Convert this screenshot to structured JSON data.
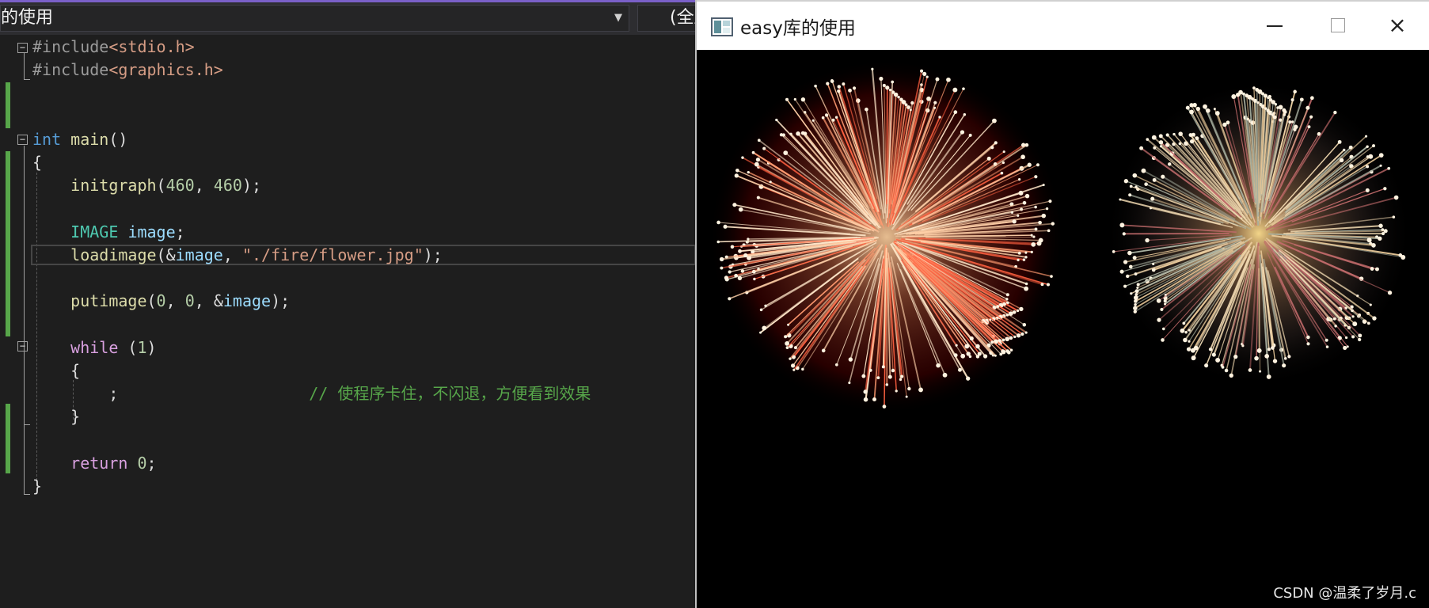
{
  "editor": {
    "scope_dropdown": "的使用",
    "member_dropdown": "(全局范围)",
    "lines": [
      [
        {
          "t": "#include",
          "c": "pp"
        },
        {
          "t": "<stdio.h>",
          "c": "inc"
        }
      ],
      [
        {
          "t": "#include",
          "c": "pp"
        },
        {
          "t": "<graphics.h>",
          "c": "inc"
        }
      ],
      [],
      [],
      [
        {
          "t": "int",
          "c": "kw"
        },
        {
          "t": " ",
          "c": "punc"
        },
        {
          "t": "main",
          "c": "fn"
        },
        {
          "t": "()",
          "c": "punc"
        }
      ],
      [
        {
          "t": "{",
          "c": "punc"
        }
      ],
      [
        {
          "t": "    ",
          "c": "punc"
        },
        {
          "t": "initgraph",
          "c": "fn"
        },
        {
          "t": "(",
          "c": "punc"
        },
        {
          "t": "460",
          "c": "num"
        },
        {
          "t": ", ",
          "c": "punc"
        },
        {
          "t": "460",
          "c": "num"
        },
        {
          "t": ");",
          "c": "punc"
        }
      ],
      [],
      [
        {
          "t": "    ",
          "c": "punc"
        },
        {
          "t": "IMAGE",
          "c": "ty"
        },
        {
          "t": " ",
          "c": "punc"
        },
        {
          "t": "image",
          "c": "var"
        },
        {
          "t": ";",
          "c": "punc"
        }
      ],
      [
        {
          "t": "    ",
          "c": "punc"
        },
        {
          "t": "loadimage",
          "c": "fn"
        },
        {
          "t": "(&",
          "c": "punc"
        },
        {
          "t": "image",
          "c": "var"
        },
        {
          "t": ", ",
          "c": "punc"
        },
        {
          "t": "\"./fire/flower.jpg\"",
          "c": "str"
        },
        {
          "t": ");",
          "c": "punc"
        }
      ],
      [],
      [
        {
          "t": "    ",
          "c": "punc"
        },
        {
          "t": "putimage",
          "c": "fn"
        },
        {
          "t": "(",
          "c": "punc"
        },
        {
          "t": "0",
          "c": "num"
        },
        {
          "t": ", ",
          "c": "punc"
        },
        {
          "t": "0",
          "c": "num"
        },
        {
          "t": ", &",
          "c": "punc"
        },
        {
          "t": "image",
          "c": "var"
        },
        {
          "t": ");",
          "c": "punc"
        }
      ],
      [],
      [
        {
          "t": "    ",
          "c": "punc"
        },
        {
          "t": "while",
          "c": "ctl"
        },
        {
          "t": " (",
          "c": "punc"
        },
        {
          "t": "1",
          "c": "num"
        },
        {
          "t": ")",
          "c": "punc"
        }
      ],
      [
        {
          "t": "    {",
          "c": "punc"
        }
      ],
      [
        {
          "t": "        ;",
          "c": "punc"
        },
        {
          "t": "                    ",
          "c": "punc"
        },
        {
          "t": "// 使程序卡住，不闪退，方便看到效果",
          "c": "cmt"
        }
      ],
      [
        {
          "t": "    }",
          "c": "punc"
        }
      ],
      [],
      [
        {
          "t": "    ",
          "c": "punc"
        },
        {
          "t": "return",
          "c": "ctl"
        },
        {
          "t": " ",
          "c": "punc"
        },
        {
          "t": "0",
          "c": "num"
        },
        {
          "t": ";",
          "c": "punc"
        }
      ],
      [
        {
          "t": "}",
          "c": "punc"
        }
      ]
    ]
  },
  "app_window": {
    "title": "easy库的使用",
    "buttons": {
      "minimize": "minimize-icon",
      "maximize": "maximize-icon",
      "close": "×"
    },
    "image_file": "./fire/flower.jpg",
    "watermark": "CSDN @温柔了岁月.c"
  }
}
